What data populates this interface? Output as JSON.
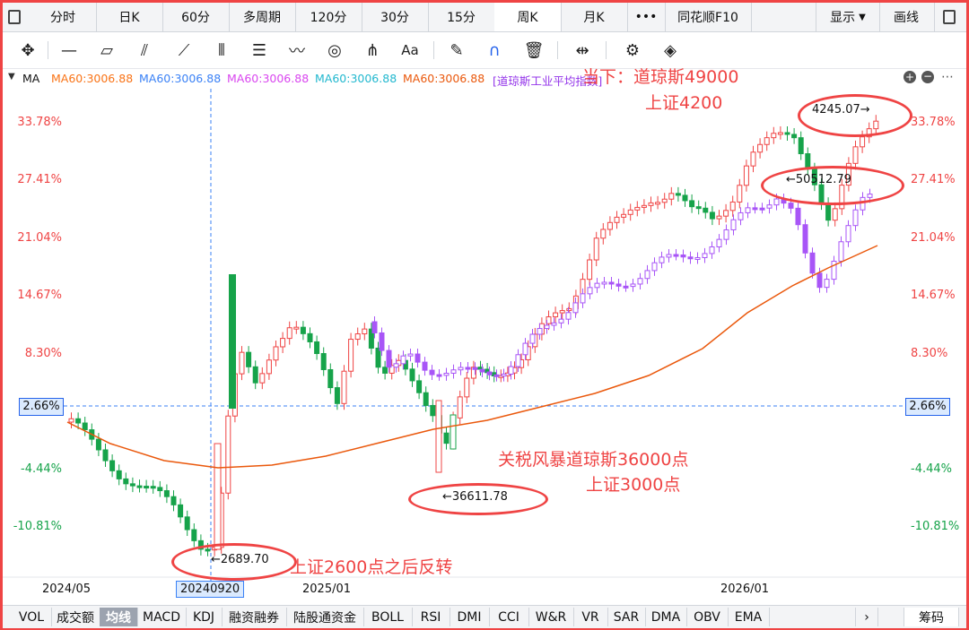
{
  "tabs": [
    "分时",
    "日K",
    "60分",
    "多周期",
    "120分",
    "30分",
    "15分",
    "周K",
    "月K",
    "•••",
    "同花顺F10"
  ],
  "active_tab": "周K",
  "right_menu": {
    "display": "显示",
    "draw": "画线"
  },
  "ma_bar": {
    "label": "MA",
    "items": [
      {
        "text": "MA60:3006.88",
        "color": "#f97316"
      },
      {
        "text": "MA60:3006.88",
        "color": "#3b82f6"
      },
      {
        "text": "MA60:3006.88",
        "color": "#d946ef"
      },
      {
        "text": "MA60:3006.88",
        "color": "#22b8cf"
      },
      {
        "text": "MA60:3006.88",
        "color": "#ea580c"
      },
      {
        "text": "[道琼斯工业平均指数]",
        "color": "#9333ea"
      }
    ]
  },
  "axis": {
    "left_pct": [
      "33.78%",
      "27.41%",
      "21.04%",
      "14.67%",
      "8.30%",
      "2.66%",
      "-4.44%",
      "-10.81%"
    ],
    "right_pct": [
      "33.78%",
      "27.41%",
      "21.04%",
      "14.67%",
      "8.30%",
      "2.66%",
      "-4.44%",
      "-10.81%"
    ],
    "dates": [
      "2024/05",
      "20240920",
      "2025/01",
      "2026/01"
    ]
  },
  "annotations": {
    "top1": "当下：道琼斯49000",
    "top2": "上证4200",
    "mid1": "关税风暴道琼斯36000点",
    "mid2": "上证3000点",
    "bottom": "上证2600点之后反转"
  },
  "price_labels": {
    "high": "4245.07→",
    "dow_high": "←50512.79",
    "tariff_low": "←36611.78",
    "low": "←2689.70"
  },
  "indicators": [
    "VOL",
    "成交额",
    "均线",
    "MACD",
    "KDJ",
    "融资融券",
    "陆股通资金",
    "BOLL",
    "RSI",
    "DMI",
    "CCI",
    "W&R",
    "VR",
    "SAR",
    "DMA",
    "OBV",
    "EMA"
  ],
  "active_indicator": "均线",
  "chips_label": "筹码",
  "colors": {
    "up": "#ef4444",
    "down": "#16a34a",
    "dow": "#a855f7",
    "ma": "#ea580c",
    "accent": "#ef4444"
  }
}
